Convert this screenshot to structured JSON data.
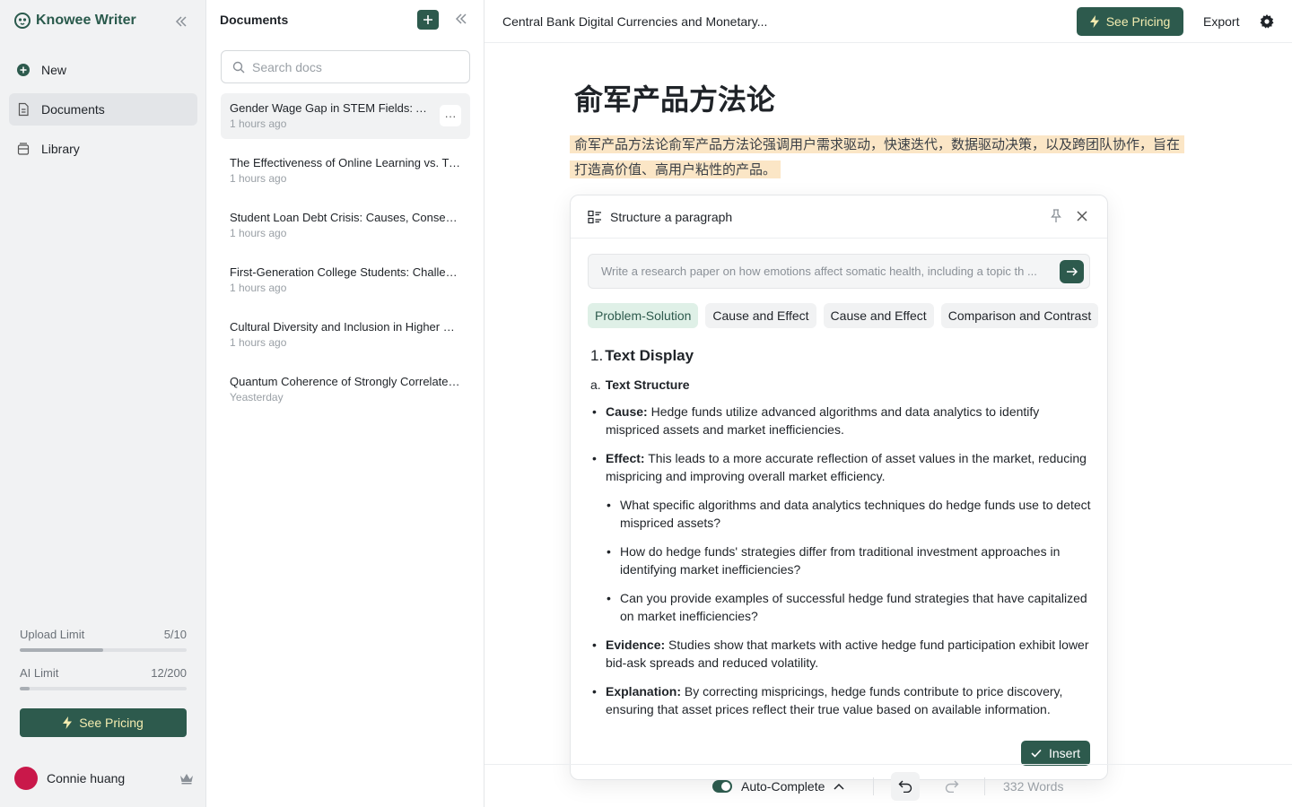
{
  "app": {
    "name": "Knowee Writer"
  },
  "sidebar": {
    "items": [
      {
        "label": "New",
        "icon": "plus-circle-icon"
      },
      {
        "label": "Documents",
        "icon": "document-icon"
      },
      {
        "label": "Library",
        "icon": "library-icon"
      }
    ],
    "limits": [
      {
        "label": "Upload Limit",
        "value": "5/10",
        "fraction": 0.5
      },
      {
        "label": "AI Limit",
        "value": "12/200",
        "fraction": 0.06
      }
    ],
    "pricing_label": "See Pricing",
    "user": {
      "name": "Connie huang"
    }
  },
  "docs": {
    "title": "Documents",
    "search_placeholder": "Search docs",
    "items": [
      {
        "title": "Gender Wage Gap in STEM Fields: Analyzing Causes and Solutions",
        "time": "1 hours ago"
      },
      {
        "title": "The Effectiveness of Online Learning vs. Traditional Classroom",
        "time": "1 hours ago"
      },
      {
        "title": "Student Loan Debt Crisis: Causes, Consequences and Solutions",
        "time": "1 hours ago"
      },
      {
        "title": "First-Generation College Students: Challenges and Support",
        "time": "1 hours ago"
      },
      {
        "title": "Cultural Diversity and Inclusion in Higher Education",
        "time": "1 hours ago"
      },
      {
        "title": "Quantum Coherence of Strongly Correlated Systems",
        "time": "Yeasterday"
      }
    ],
    "more_label": "···"
  },
  "editor": {
    "doc_title": "Central Bank Digital Currencies and Monetary...",
    "pricing_label": "See Pricing",
    "export_label": "Export",
    "heading": "俞军产品方法论",
    "paragraph": "俞军产品方法论俞军产品方法论强调用户需求驱动，快速迭代，数据驱动决策，以及跨团队协作，旨在打造高价值、高用户粘性的产品。",
    "autocomplete_label": "Auto-Complete",
    "word_count": "332 Words"
  },
  "panel": {
    "title": "Structure a paragraph",
    "prompt_placeholder": "Write a research paper on how emotions affect somatic health, including a topic th ...",
    "chips": [
      "Problem-Solution",
      "Cause and Effect",
      "Cause and Effect",
      "Comparison and Contrast"
    ],
    "heading_num": "1.",
    "heading": "Text Display",
    "sub_num": "a.",
    "sub": "Text Structure",
    "points": [
      {
        "label": "Cause:",
        "text": " Hedge funds utilize advanced algorithms and data analytics to identify mispriced assets and market inefficiencies."
      },
      {
        "label": "Effect:",
        "text": " This leads to a more accurate reflection of asset values in the market, reducing mispricing and improving overall market efficiency."
      }
    ],
    "questions": [
      "What specific algorithms and data analytics techniques do hedge funds use to detect mispriced assets?",
      "How do hedge funds' strategies differ from traditional investment approaches in identifying market inefficiencies?",
      "Can you provide examples of successful hedge fund strategies that have capitalized on market inefficiencies?"
    ],
    "points2": [
      {
        "label": "Evidence:",
        "text": " Studies show that markets with active hedge fund participation exhibit lower bid-ask spreads and reduced volatility."
      },
      {
        "label": "Explanation:",
        "text": " By correcting mispricings, hedge funds contribute to price discovery, ensuring that asset prices reflect their true value based on available information."
      }
    ],
    "insert_label": "Insert"
  },
  "colors": {
    "accent": "#2d5a4d",
    "highlight": "#fbe6c6",
    "chip_active": "#dff0e7",
    "avatar": "#c9184a"
  }
}
